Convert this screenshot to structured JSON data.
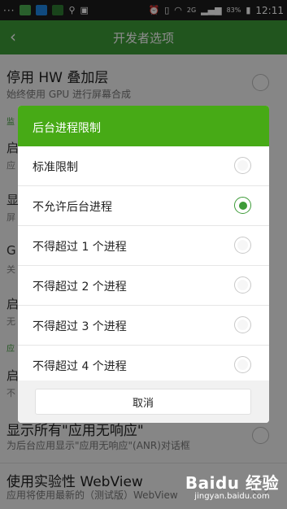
{
  "statusbar": {
    "dots": "···",
    "signal_text": "2G",
    "battery": "83%",
    "time": "12:11"
  },
  "appbar": {
    "back_glyph": "‹",
    "title": "开发者选项"
  },
  "background": {
    "hw_overlay_title": "停用 HW 叠加层",
    "hw_overlay_sub": "始终使用 GPU 进行屏幕合成",
    "frag_monitor": "监",
    "frag_1": "启",
    "frag_1_sub": "应",
    "frag_2": "显",
    "frag_2_sub": "屏",
    "frag_3": "G",
    "frag_3_sub": "关",
    "frag_4": "启",
    "frag_4_sub": "无",
    "frag_app": "应",
    "frag_5": "启",
    "frag_5_sub": "不",
    "anr_title": "显示所有\"应用无响应\"",
    "anr_sub": "为后台应用显示\"应用无响应\"(ANR)对话框",
    "webview_title": "使用实验性 WebView",
    "webview_sub": "应用将使用最新的（测试版）WebView"
  },
  "dialog": {
    "title": "后台进程限制",
    "options": [
      {
        "label": "标准限制",
        "selected": false
      },
      {
        "label": "不允许后台进程",
        "selected": true
      },
      {
        "label": "不得超过 1 个进程",
        "selected": false
      },
      {
        "label": "不得超过 2 个进程",
        "selected": false
      },
      {
        "label": "不得超过 3 个进程",
        "selected": false
      },
      {
        "label": "不得超过 4 个进程",
        "selected": false
      }
    ],
    "cancel_label": "取消"
  },
  "watermark": {
    "logo": "Baidu 经验",
    "sub": "jingyan.baidu.com"
  },
  "colors": {
    "appbar": "#3d9b38",
    "dialog_title": "#47aa16",
    "radio_selected": "#3d9b38"
  }
}
